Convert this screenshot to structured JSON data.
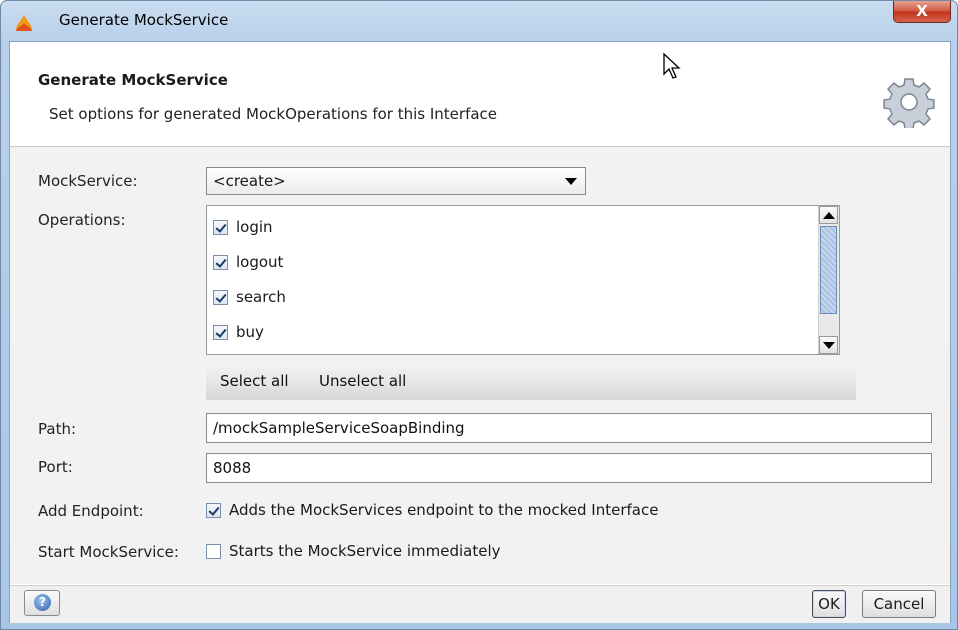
{
  "window": {
    "title": "Generate MockService",
    "close_label": "X"
  },
  "header": {
    "title": "Generate MockService",
    "description": "Set options for generated MockOperations for this Interface"
  },
  "form": {
    "mockservice_label": "MockService:",
    "mockservice_value": "<create>",
    "operations_label": "Operations:",
    "operations": [
      {
        "label": "login",
        "checked": true
      },
      {
        "label": "logout",
        "checked": true
      },
      {
        "label": "search",
        "checked": true
      },
      {
        "label": "buy",
        "checked": true
      }
    ],
    "select_all": "Select all",
    "unselect_all": "Unselect all",
    "path_label": "Path:",
    "path_value": "/mockSampleServiceSoapBinding",
    "port_label": "Port:",
    "port_value": "8088",
    "add_endpoint_label": "Add Endpoint:",
    "add_endpoint_text": "Adds the MockServices endpoint to the mocked Interface",
    "add_endpoint_checked": true,
    "start_label": "Start MockService:",
    "start_text": "Starts the MockService immediately",
    "start_checked": false
  },
  "footer": {
    "ok_label": "OK",
    "cancel_label": "Cancel"
  },
  "icons": {
    "app": "soapui-logo-icon",
    "header": "gear-icon",
    "help": "help-icon"
  }
}
